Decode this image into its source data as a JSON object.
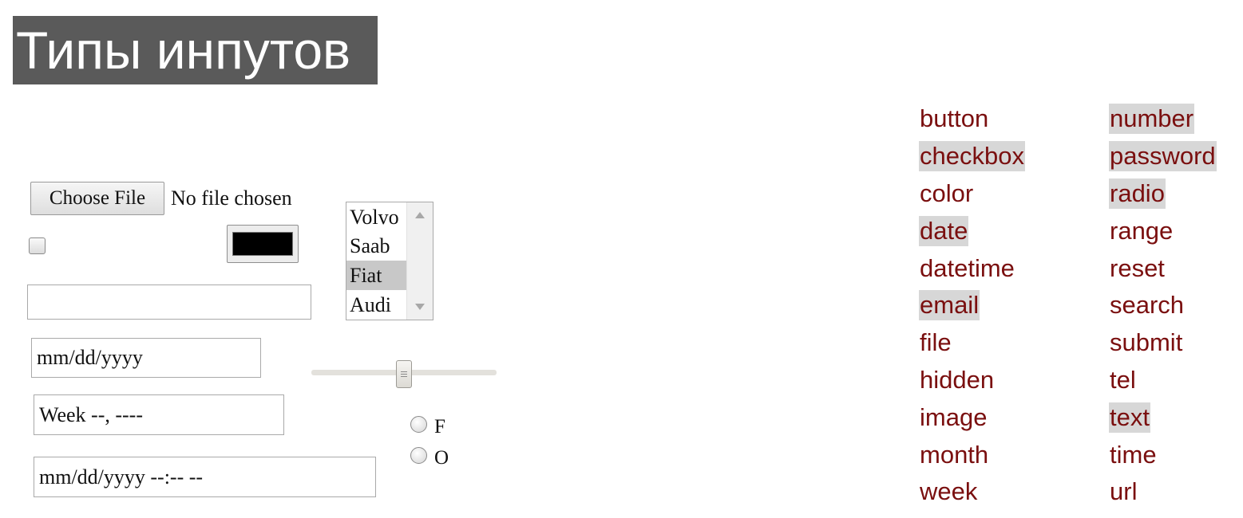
{
  "title": "Типы инпутов",
  "file_input": {
    "button_label": "Choose File",
    "status": "No file chosen"
  },
  "checkbox": {
    "checked": false
  },
  "color_input": {
    "value": "#000000"
  },
  "text_input": {
    "value": ""
  },
  "date_input": {
    "placeholder": "mm/dd/yyyy"
  },
  "week_input": {
    "placeholder": "Week --, ----"
  },
  "datetime_input": {
    "placeholder": "mm/dd/yyyy --:-- --"
  },
  "select": {
    "options": [
      "Volvo",
      "Saab",
      "Fiat",
      "Audi"
    ],
    "selected": "Fiat"
  },
  "range": {
    "value_fraction": 0.5
  },
  "radios": [
    {
      "label": "F",
      "checked": false
    },
    {
      "label": "O",
      "checked": false
    }
  ],
  "input_types": {
    "column1": [
      {
        "label": "button",
        "highlighted": false
      },
      {
        "label": "checkbox",
        "highlighted": true
      },
      {
        "label": "color",
        "highlighted": false
      },
      {
        "label": "date",
        "highlighted": true
      },
      {
        "label": "datetime",
        "highlighted": false
      },
      {
        "label": "email",
        "highlighted": true
      },
      {
        "label": "file",
        "highlighted": false
      },
      {
        "label": "hidden",
        "highlighted": false
      },
      {
        "label": "image",
        "highlighted": false
      },
      {
        "label": "month",
        "highlighted": false
      },
      {
        "label": "week",
        "highlighted": false
      }
    ],
    "column2": [
      {
        "label": "number",
        "highlighted": true
      },
      {
        "label": "password",
        "highlighted": true
      },
      {
        "label": "radio",
        "highlighted": true
      },
      {
        "label": "range",
        "highlighted": false
      },
      {
        "label": "reset",
        "highlighted": false
      },
      {
        "label": "search",
        "highlighted": false
      },
      {
        "label": "submit",
        "highlighted": false
      },
      {
        "label": "tel",
        "highlighted": false
      },
      {
        "label": "text",
        "highlighted": true
      },
      {
        "label": "time",
        "highlighted": false
      },
      {
        "label": "url",
        "highlighted": false
      }
    ]
  },
  "colors": {
    "title_bg": "#5a5a5a",
    "link_text": "#7a0f0f",
    "highlight_bg": "#d7d7d7",
    "selected_option_bg": "#c8c8c8"
  }
}
